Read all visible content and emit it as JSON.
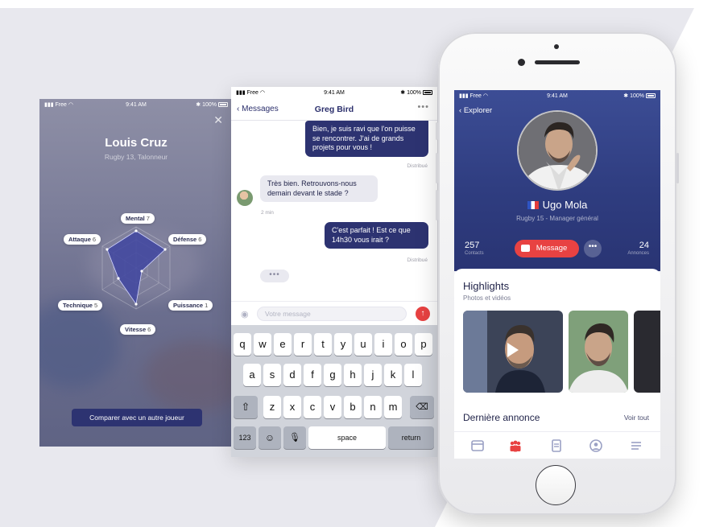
{
  "left": {
    "status": {
      "carrier": "Free",
      "time": "9:41 AM",
      "battery": "100%"
    },
    "name": "Louis Cruz",
    "subtitle": "Rugby 13, Talonneur",
    "stats": [
      {
        "label": "Mental",
        "value": 7
      },
      {
        "label": "Défense",
        "value": 6
      },
      {
        "label": "Puissance",
        "value": 1
      },
      {
        "label": "Vitesse",
        "value": 6
      },
      {
        "label": "Technique",
        "value": 5
      },
      {
        "label": "Attaque",
        "value": 6
      }
    ],
    "compare_label": "Comparer avec un autre joueur"
  },
  "middle": {
    "status": {
      "carrier": "Free",
      "time": "9:41 AM",
      "battery": "100%"
    },
    "back_label": "Messages",
    "contact_name": "Greg Bird",
    "messages": [
      {
        "dir": "out",
        "text": "Bien, je suis ravi que l'on puisse se rencontrer. J'ai de grands projets pour vous !",
        "meta": "Distribué"
      },
      {
        "dir": "in",
        "text": "Très bien. Retrouvons-nous demain devant le stade ?",
        "meta": "2 min"
      },
      {
        "dir": "out",
        "text": "C'est parfait ! Est ce que 14h30 vous irait ?",
        "meta": "Distribué"
      }
    ],
    "typing": "•••",
    "input_placeholder": "Votre message",
    "keyboard": {
      "row1": [
        "q",
        "w",
        "e",
        "r",
        "t",
        "y",
        "u",
        "i",
        "o",
        "p"
      ],
      "row2": [
        "a",
        "s",
        "d",
        "f",
        "g",
        "h",
        "j",
        "k",
        "l"
      ],
      "row3": [
        "z",
        "x",
        "c",
        "v",
        "b",
        "n",
        "m"
      ],
      "numbers_label": "123",
      "space_label": "space",
      "return_label": "return"
    }
  },
  "phone": {
    "status": {
      "carrier": "Free",
      "time": "9:41 AM",
      "battery": "100%"
    },
    "back_label": "Explorer",
    "name": "Ugo Mola",
    "role": "Rugby 15 -  Manager général",
    "contacts_count": "257",
    "contacts_label": "Contacts",
    "annonces_count": "24",
    "annonces_label": "Annonces",
    "message_label": "Message",
    "highlights_title": "Highlights",
    "highlights_subtitle": "Photos et vidéos",
    "last_ad_title": "Dernière annonce",
    "see_all": "Voir tout",
    "tabs": [
      "calendar-icon",
      "team-icon",
      "document-icon",
      "profile-icon",
      "menu-icon"
    ],
    "accent": "#e84242"
  }
}
